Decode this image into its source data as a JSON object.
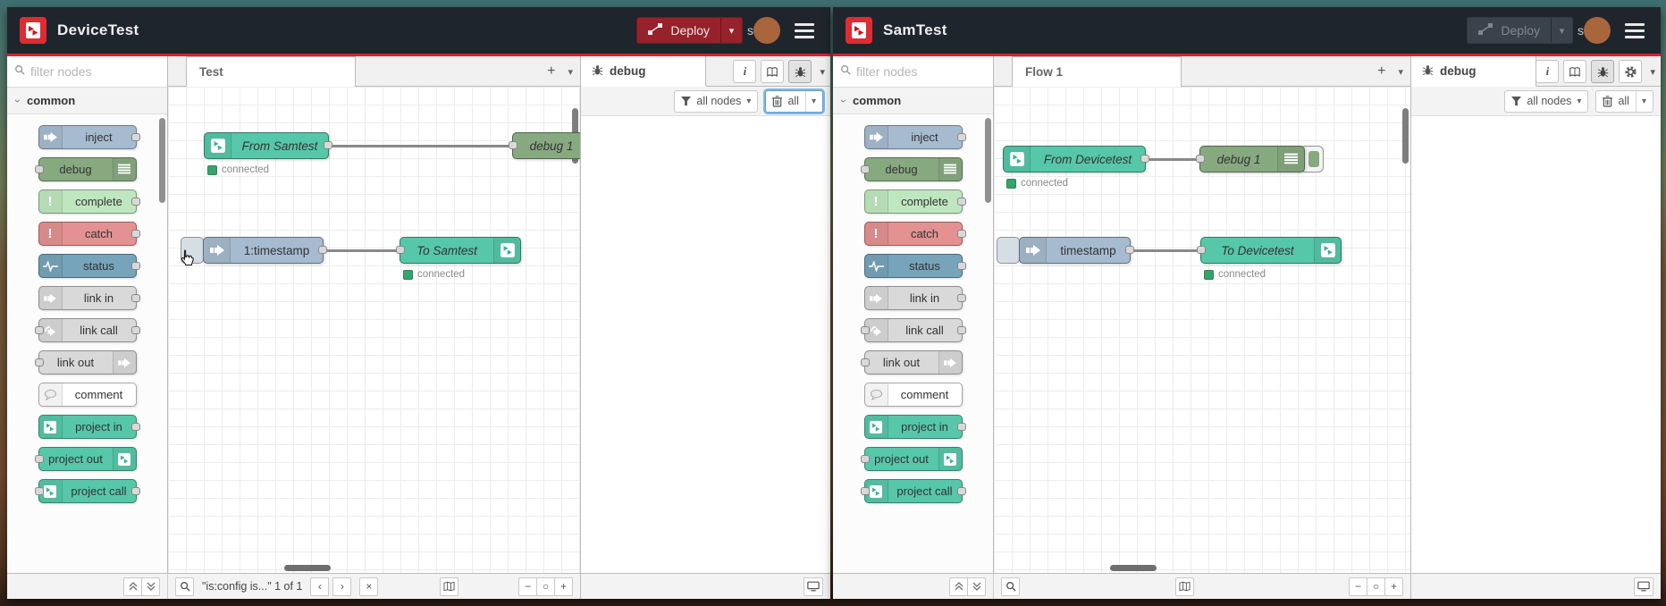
{
  "colors": {
    "accent_red": "#dc2127",
    "header_bg": "#1f252d",
    "deploy_red": "#96222b",
    "logo_red": "#e02b33",
    "node_inject": "#a6bbcf",
    "node_debug": "#87a980",
    "node_complete": "#bfe7bf",
    "node_catch": "#e49191",
    "node_status": "#76a4ba",
    "node_link": "#d9d9d9",
    "node_comment": "#ffffff",
    "node_project": "#56c7a9",
    "status_green": "#37a26c",
    "avatar_brown": "#a9653c"
  },
  "palette": {
    "filter_placeholder": "filter nodes",
    "category_label": "common",
    "items": [
      {
        "label": "inject",
        "icon": "inject-arrow-icon"
      },
      {
        "label": "debug",
        "icon": "debug-list-icon"
      },
      {
        "label": "complete",
        "icon": "exclamation-icon"
      },
      {
        "label": "catch",
        "icon": "exclamation-icon"
      },
      {
        "label": "status",
        "icon": "status-pulse-icon"
      },
      {
        "label": "link in",
        "icon": "link-arrow-icon"
      },
      {
        "label": "link call",
        "icon": "link-arrow-icon"
      },
      {
        "label": "link out",
        "icon": "link-arrow-icon"
      },
      {
        "label": "comment",
        "icon": "comment-bubble-icon"
      },
      {
        "label": "project in",
        "icon": "project-icon"
      },
      {
        "label": "project out",
        "icon": "project-icon"
      },
      {
        "label": "project call",
        "icon": "project-icon"
      }
    ]
  },
  "windows": [
    {
      "title": "DeviceTest",
      "deploy_label": "Deploy",
      "user_initial": "s",
      "flow_tab": "Test",
      "sidebar_tab": "debug",
      "filter_nodes_label": "all nodes",
      "clear_label": "all",
      "search_text": "\"is:config is...\" 1 of 1",
      "search_caret_prev": "‹",
      "search_caret_next": "›",
      "search_close": "×",
      "nodes": {
        "r1_source": "From Samtest",
        "r1_source_status": "connected",
        "r1_target": "debug 1",
        "r2_source": "1:timestamp",
        "r2_target": "To Samtest",
        "r2_target_status": "connected"
      }
    },
    {
      "title": "SamTest",
      "deploy_label": "Deploy",
      "user_initial": "s",
      "flow_tab": "Flow 1",
      "sidebar_tab": "debug",
      "filter_nodes_label": "all nodes",
      "clear_label": "all",
      "nodes": {
        "r1_source": "From Devicetest",
        "r1_source_status": "connected",
        "r1_target": "debug 1",
        "r2_source": "timestamp",
        "r2_target": "To Devicetest",
        "r2_target_status": "connected"
      }
    }
  ]
}
